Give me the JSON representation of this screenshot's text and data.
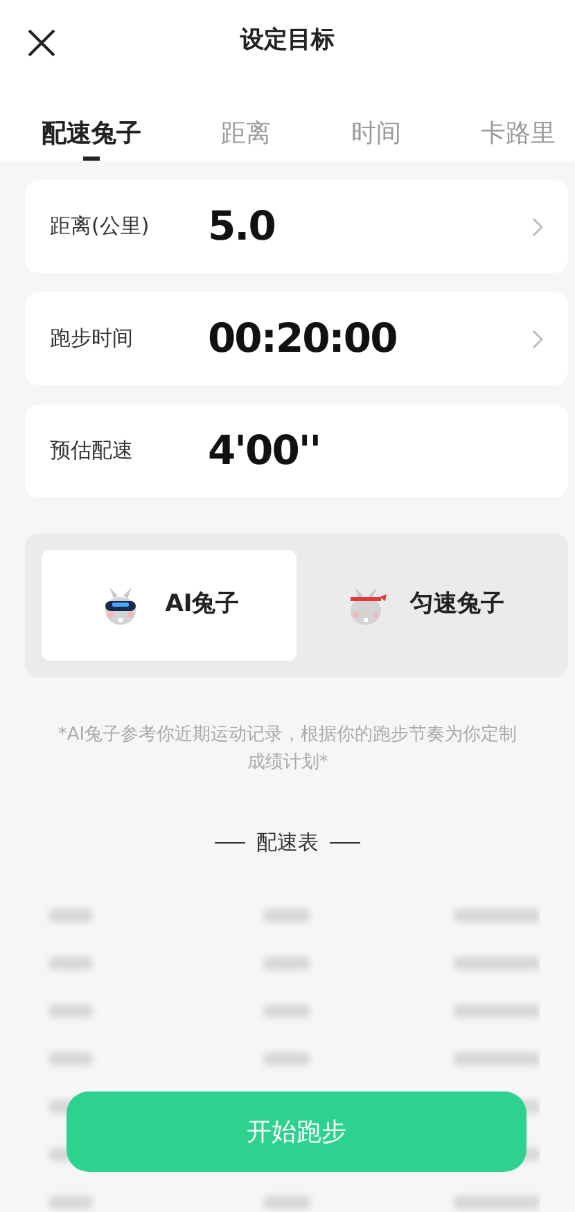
{
  "header": {
    "title": "设定目标"
  },
  "tabs": [
    {
      "label": "配速兔子",
      "selected": true
    },
    {
      "label": "距离",
      "selected": false
    },
    {
      "label": "时间",
      "selected": false
    },
    {
      "label": "卡路里",
      "selected": false
    }
  ],
  "settings": [
    {
      "label": "距离(公里)",
      "value": "5.0",
      "has_arrow": true
    },
    {
      "label": "跑步时间",
      "value": "00:20:00",
      "has_arrow": true
    },
    {
      "label": "预估配速",
      "value": "4'00''",
      "has_arrow": false
    }
  ],
  "rabbit_modes": [
    {
      "kind": "ai",
      "label": "AI兔子",
      "selected": true
    },
    {
      "kind": "steady",
      "label": "匀速兔子",
      "selected": false
    }
  ],
  "note": "*AI兔子参考你近期运动记录，根据你的跑步节奏为你定制成绩计划*",
  "pace_table": {
    "title": "配速表"
  },
  "start_button": "开始跑步"
}
